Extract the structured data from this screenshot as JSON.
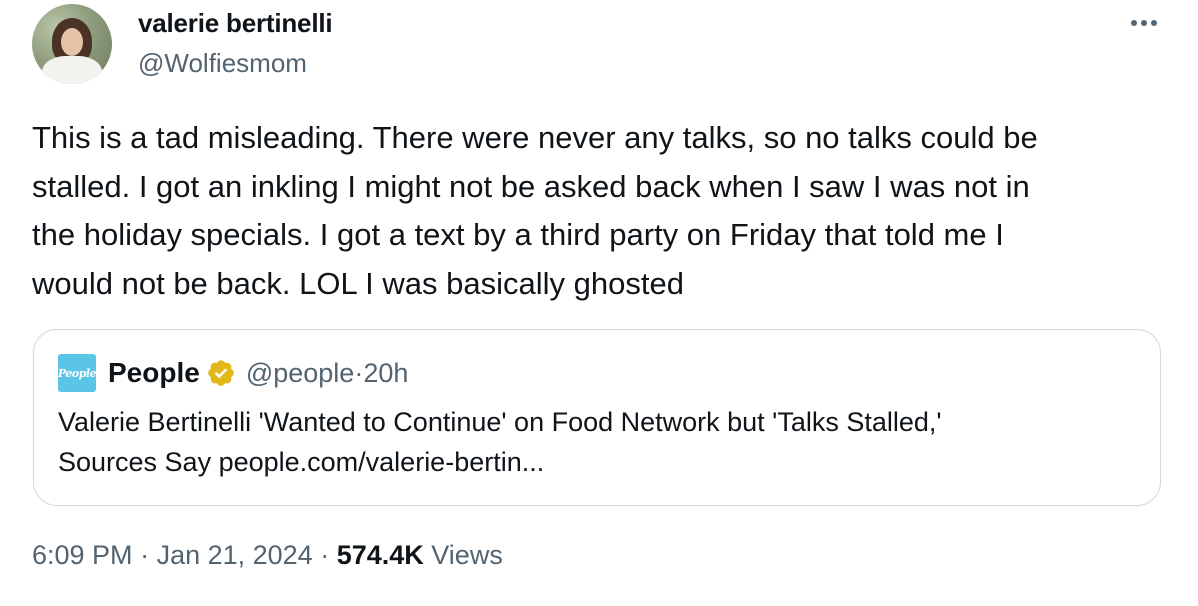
{
  "author": {
    "display_name": "valerie bertinelli",
    "handle": "@Wolfiesmom",
    "avatar_icon": "profile-photo"
  },
  "more_icon": "more-horizontal-icon",
  "tweet": {
    "text": "This is a tad misleading. There were never any talks, so no talks could be\nstalled. I got an inkling I might not be asked back when I saw I was not in\nthe holiday specials. I got a text by a third party on Friday that told me I\nwould not be back. LOL I was basically ghosted"
  },
  "quote": {
    "logo_text": "People",
    "name": "People",
    "verified_icon": "verified-badge-gold-icon",
    "verified_color": "#e2b719",
    "handle": "@people",
    "separator": " · ",
    "time": "20h",
    "text": "Valerie Bertinelli 'Wanted to Continue' on Food Network but 'Talks Stalled,'\nSources Say people.com/valerie-bertin..."
  },
  "footer": {
    "time": "6:09 PM",
    "separator1": " · ",
    "date": "Jan 21, 2024",
    "separator2": " · ",
    "views_count": "574.4K",
    "views_label": " Views"
  },
  "colors": {
    "text_primary": "#0f1419",
    "text_secondary": "#536471",
    "border": "#cfd9de",
    "people_brand": "#5bc5e8"
  }
}
